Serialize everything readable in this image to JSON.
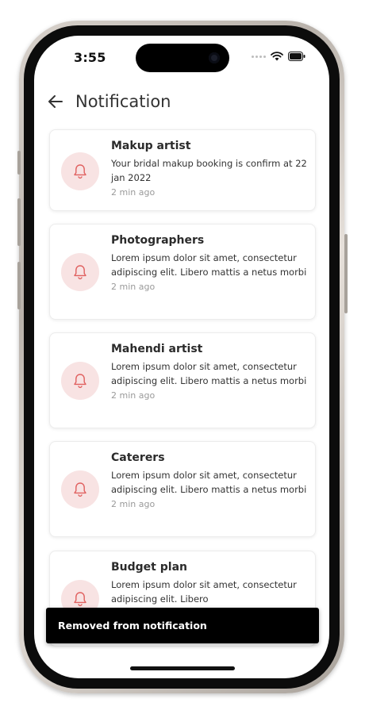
{
  "status_bar": {
    "time": "3:55"
  },
  "header": {
    "title": "Notification"
  },
  "notifications": [
    {
      "title": "Makup artist",
      "message": "Your bridal makup booking is confirm at 22 jan 2022",
      "time": "2 min ago"
    },
    {
      "title": "Photographers",
      "message": "Lorem ipsum dolor sit amet, consectetur adipiscing elit. Libero mattis a netus morbi",
      "time": "2 min ago"
    },
    {
      "title": "Mahendi artist",
      "message": "Lorem ipsum dolor sit amet, consectetur adipiscing elit. Libero mattis a netus morbi",
      "time": "2 min ago"
    },
    {
      "title": "Caterers",
      "message": "Lorem ipsum dolor sit amet, consectetur adipiscing elit. Libero mattis a netus morbi",
      "time": "2 min ago"
    },
    {
      "title": "Budget plan",
      "message": "Lorem ipsum dolor sit amet, consectetur adipiscing elit. Libero",
      "time": ""
    }
  ],
  "toast": {
    "message": "Removed from notification"
  },
  "colors": {
    "accent": "#e0605f",
    "icon_bg": "#f8e3e3",
    "toast_bg": "#000000"
  },
  "icons": {
    "back": "arrow-left-icon",
    "notification": "bell-icon"
  }
}
